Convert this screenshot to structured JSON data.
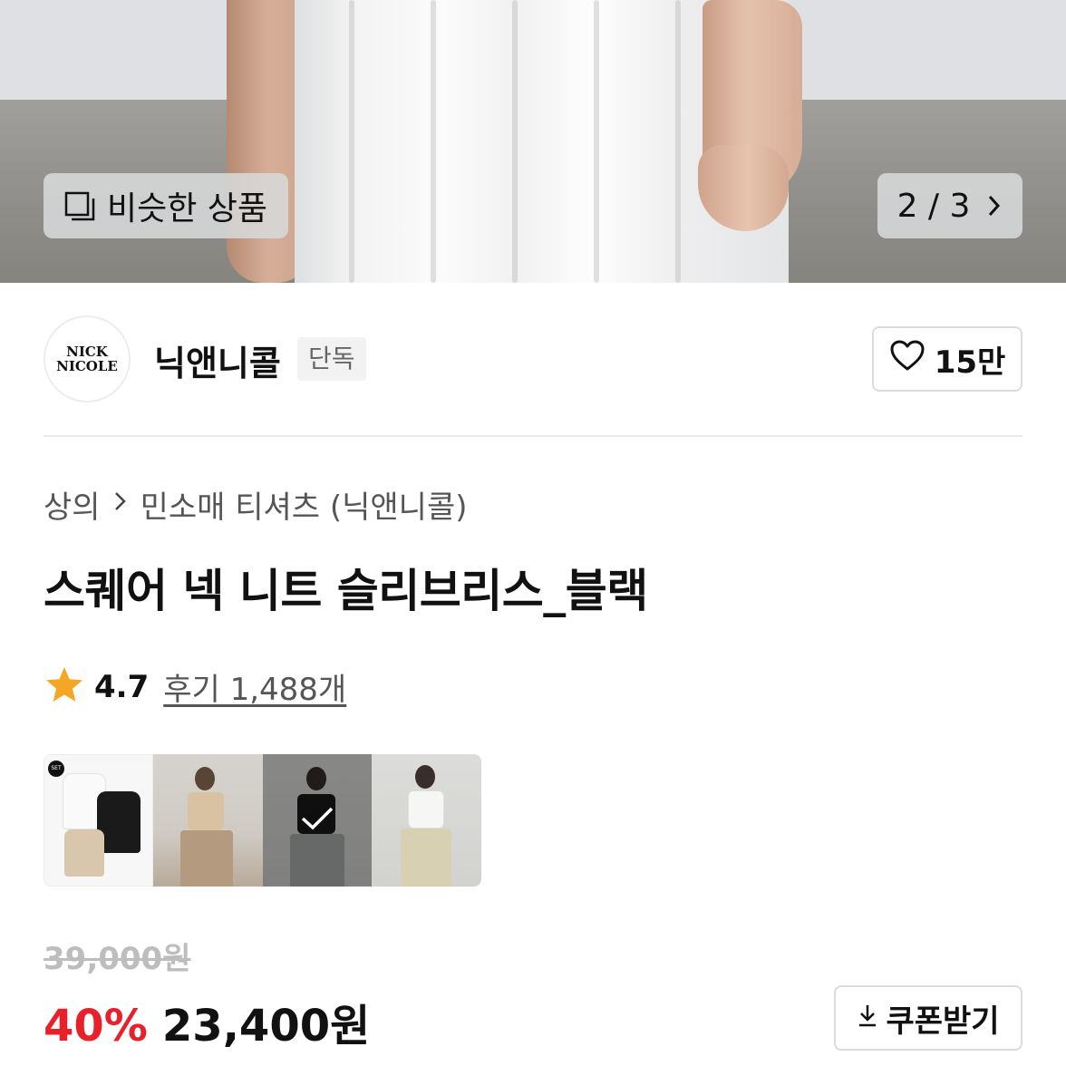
{
  "hero": {
    "similar_label": "비슷한 상품",
    "pager_current": "2",
    "pager_total": "3",
    "pager_text": "2 / 3"
  },
  "brand": {
    "logo_line1": "NICK",
    "logo_line2": "NICOLE",
    "name": "닉앤니콜",
    "exclusive_badge": "단독",
    "likes": "15만"
  },
  "breadcrumb": {
    "category": "상의",
    "subcategory": "민소매 티셔츠 (닉앤니콜)"
  },
  "product": {
    "title": "스퀘어 넥 니트 슬리브리스_블랙"
  },
  "rating": {
    "score": "4.7",
    "reviews": "후기 1,488개"
  },
  "thumbnails": {
    "set_badge": "SET",
    "selected_index": 2,
    "count": 4
  },
  "price": {
    "original": "39,000원",
    "discount": "40%",
    "sale": "23,400원",
    "coupon_label": "쿠폰받기"
  },
  "colors": {
    "discount_red": "#e8202a",
    "star_orange": "#f5a623"
  }
}
